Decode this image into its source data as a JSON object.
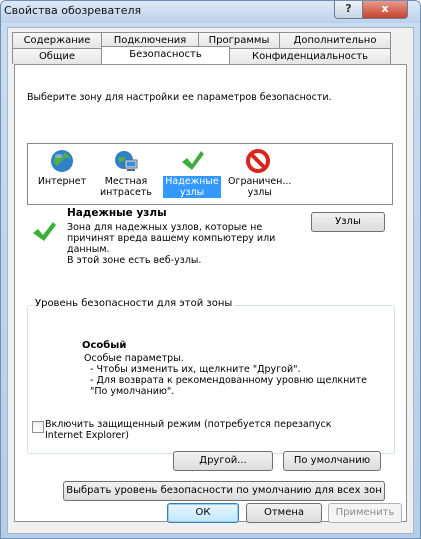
{
  "window": {
    "title": "Свойства обозревателя",
    "help_glyph": "?",
    "close_glyph": "x"
  },
  "tabs_row1": [
    "Содержание",
    "Подключения",
    "Программы",
    "Дополнительно"
  ],
  "tabs_row2": [
    "Общие",
    "Безопасность",
    "Конфиденциальность"
  ],
  "active_tab": "Безопасность",
  "zones_prompt": "Выберите зону для настройки ее параметров безопасности.",
  "zones": [
    {
      "icon": "globe-icon",
      "label": "Интернет"
    },
    {
      "icon": "local-intranet-icon",
      "label": "Местная\nинтрасеть"
    },
    {
      "icon": "checkmark-icon",
      "label": "Надежные\nузлы",
      "selected": true
    },
    {
      "icon": "restricted-icon",
      "label": "Ограничен...\nузлы"
    }
  ],
  "selected_zone": {
    "title": "Надежные узлы",
    "description": "Зона для надежных узлов, которые не\nпричинят вреда вашему компьютеру или\nданным.",
    "sites_note": "В этой зоне есть веб-узлы.",
    "sites_button": "Узлы"
  },
  "security_level": {
    "group_title": "Уровень безопасности для этой зоны",
    "level_name": "Особый",
    "level_text": "Особые параметры.\n  - Чтобы изменить их, щелкните \"Другой\".\n  - Для возврата к рекомендованному уровню щелкните\n  \"По умолчанию\".",
    "protected_mode_label": "Включить защищенный режим (потребуется перезапуск\nInternet Explorer)",
    "protected_mode_checked": false,
    "custom_button": "Другой...",
    "default_button": "По умолчанию"
  },
  "reset_all_button": "Выбрать уровень безопасности по умолчанию для всех зон",
  "footer": {
    "ok": "ОК",
    "cancel": "Отмена",
    "apply": "Применить"
  },
  "colors": {
    "selection": "#3399ff",
    "check_green": "#3cae3a",
    "restricted_red": "#d9261c"
  }
}
